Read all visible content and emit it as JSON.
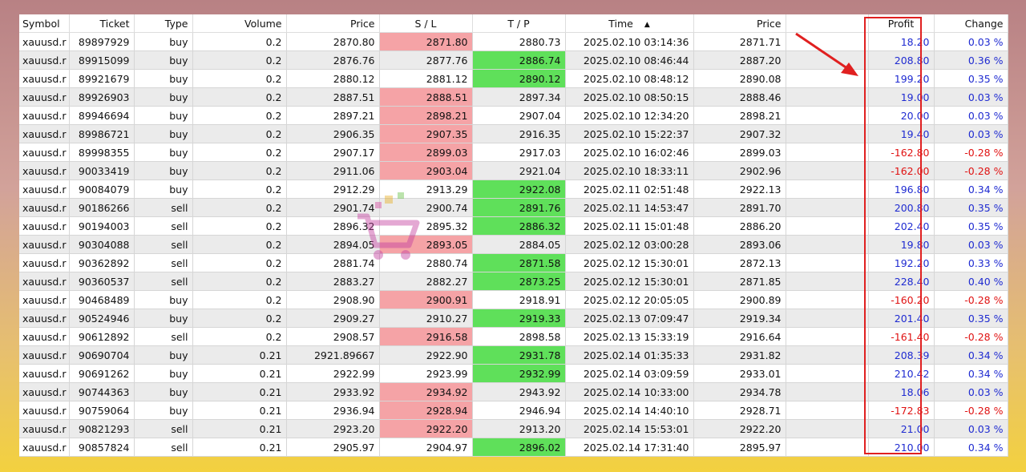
{
  "columns": {
    "symbol": "Symbol",
    "ticket": "Ticket",
    "type": "Type",
    "volume": "Volume",
    "price_open": "Price",
    "sl": "S / L",
    "tp": "T / P",
    "time": "Time",
    "price_current": "Price",
    "profit": "Profit",
    "change": "Change"
  },
  "sort": {
    "column": "time",
    "direction": "ascending",
    "icon": "sort-up-icon"
  },
  "highlight": {
    "column": "profit",
    "color": "#e02020"
  },
  "colors": {
    "sl_hit": "#f5a3a6",
    "tp_hit": "#5fe05a",
    "positive": "#1f2bd1",
    "negative": "#e01212"
  },
  "rows": [
    {
      "symbol": "xauusd.r",
      "ticket": "89897929",
      "type": "buy",
      "volume": "0.2",
      "price": "2870.80",
      "sl": "2871.80",
      "tp": "2880.73",
      "time": "2025.02.10 03:14:36",
      "price2": "2871.71",
      "profit": "18.20",
      "change": "0.03 %",
      "sl_hit": true,
      "tp_hit": false,
      "neg": false
    },
    {
      "symbol": "xauusd.r",
      "ticket": "89915099",
      "type": "buy",
      "volume": "0.2",
      "price": "2876.76",
      "sl": "2877.76",
      "tp": "2886.74",
      "time": "2025.02.10 08:46:44",
      "price2": "2887.20",
      "profit": "208.80",
      "change": "0.36 %",
      "sl_hit": false,
      "tp_hit": true,
      "neg": false
    },
    {
      "symbol": "xauusd.r",
      "ticket": "89921679",
      "type": "buy",
      "volume": "0.2",
      "price": "2880.12",
      "sl": "2881.12",
      "tp": "2890.12",
      "time": "2025.02.10 08:48:12",
      "price2": "2890.08",
      "profit": "199.20",
      "change": "0.35 %",
      "sl_hit": false,
      "tp_hit": true,
      "neg": false
    },
    {
      "symbol": "xauusd.r",
      "ticket": "89926903",
      "type": "buy",
      "volume": "0.2",
      "price": "2887.51",
      "sl": "2888.51",
      "tp": "2897.34",
      "time": "2025.02.10 08:50:15",
      "price2": "2888.46",
      "profit": "19.00",
      "change": "0.03 %",
      "sl_hit": true,
      "tp_hit": false,
      "neg": false
    },
    {
      "symbol": "xauusd.r",
      "ticket": "89946694",
      "type": "buy",
      "volume": "0.2",
      "price": "2897.21",
      "sl": "2898.21",
      "tp": "2907.04",
      "time": "2025.02.10 12:34:20",
      "price2": "2898.21",
      "profit": "20.00",
      "change": "0.03 %",
      "sl_hit": true,
      "tp_hit": false,
      "neg": false
    },
    {
      "symbol": "xauusd.r",
      "ticket": "89986721",
      "type": "buy",
      "volume": "0.2",
      "price": "2906.35",
      "sl": "2907.35",
      "tp": "2916.35",
      "time": "2025.02.10 15:22:37",
      "price2": "2907.32",
      "profit": "19.40",
      "change": "0.03 %",
      "sl_hit": true,
      "tp_hit": false,
      "neg": false
    },
    {
      "symbol": "xauusd.r",
      "ticket": "89998355",
      "type": "buy",
      "volume": "0.2",
      "price": "2907.17",
      "sl": "2899.03",
      "tp": "2917.03",
      "time": "2025.02.10 16:02:46",
      "price2": "2899.03",
      "profit": "-162.80",
      "change": "-0.28 %",
      "sl_hit": true,
      "tp_hit": false,
      "neg": true
    },
    {
      "symbol": "xauusd.r",
      "ticket": "90033419",
      "type": "buy",
      "volume": "0.2",
      "price": "2911.06",
      "sl": "2903.04",
      "tp": "2921.04",
      "time": "2025.02.10 18:33:11",
      "price2": "2902.96",
      "profit": "-162.00",
      "change": "-0.28 %",
      "sl_hit": true,
      "tp_hit": false,
      "neg": true
    },
    {
      "symbol": "xauusd.r",
      "ticket": "90084079",
      "type": "buy",
      "volume": "0.2",
      "price": "2912.29",
      "sl": "2913.29",
      "tp": "2922.08",
      "time": "2025.02.11 02:51:48",
      "price2": "2922.13",
      "profit": "196.80",
      "change": "0.34 %",
      "sl_hit": false,
      "tp_hit": true,
      "neg": false
    },
    {
      "symbol": "xauusd.r",
      "ticket": "90186266",
      "type": "sell",
      "volume": "0.2",
      "price": "2901.74",
      "sl": "2900.74",
      "tp": "2891.76",
      "time": "2025.02.11 14:53:47",
      "price2": "2891.70",
      "profit": "200.80",
      "change": "0.35 %",
      "sl_hit": false,
      "tp_hit": true,
      "neg": false
    },
    {
      "symbol": "xauusd.r",
      "ticket": "90194003",
      "type": "sell",
      "volume": "0.2",
      "price": "2896.32",
      "sl": "2895.32",
      "tp": "2886.32",
      "time": "2025.02.11 15:01:48",
      "price2": "2886.20",
      "profit": "202.40",
      "change": "0.35 %",
      "sl_hit": false,
      "tp_hit": true,
      "neg": false
    },
    {
      "symbol": "xauusd.r",
      "ticket": "90304088",
      "type": "sell",
      "volume": "0.2",
      "price": "2894.05",
      "sl": "2893.05",
      "tp": "2884.05",
      "time": "2025.02.12 03:00:28",
      "price2": "2893.06",
      "profit": "19.80",
      "change": "0.03 %",
      "sl_hit": true,
      "tp_hit": false,
      "neg": false
    },
    {
      "symbol": "xauusd.r",
      "ticket": "90362892",
      "type": "sell",
      "volume": "0.2",
      "price": "2881.74",
      "sl": "2880.74",
      "tp": "2871.58",
      "time": "2025.02.12 15:30:01",
      "price2": "2872.13",
      "profit": "192.20",
      "change": "0.33 %",
      "sl_hit": false,
      "tp_hit": true,
      "neg": false
    },
    {
      "symbol": "xauusd.r",
      "ticket": "90360537",
      "type": "sell",
      "volume": "0.2",
      "price": "2883.27",
      "sl": "2882.27",
      "tp": "2873.25",
      "time": "2025.02.12 15:30:01",
      "price2": "2871.85",
      "profit": "228.40",
      "change": "0.40 %",
      "sl_hit": false,
      "tp_hit": true,
      "neg": false
    },
    {
      "symbol": "xauusd.r",
      "ticket": "90468489",
      "type": "buy",
      "volume": "0.2",
      "price": "2908.90",
      "sl": "2900.91",
      "tp": "2918.91",
      "time": "2025.02.12 20:05:05",
      "price2": "2900.89",
      "profit": "-160.20",
      "change": "-0.28 %",
      "sl_hit": true,
      "tp_hit": false,
      "neg": true
    },
    {
      "symbol": "xauusd.r",
      "ticket": "90524946",
      "type": "buy",
      "volume": "0.2",
      "price": "2909.27",
      "sl": "2910.27",
      "tp": "2919.33",
      "time": "2025.02.13 07:09:47",
      "price2": "2919.34",
      "profit": "201.40",
      "change": "0.35 %",
      "sl_hit": false,
      "tp_hit": true,
      "neg": false
    },
    {
      "symbol": "xauusd.r",
      "ticket": "90612892",
      "type": "sell",
      "volume": "0.2",
      "price": "2908.57",
      "sl": "2916.58",
      "tp": "2898.58",
      "time": "2025.02.13 15:33:19",
      "price2": "2916.64",
      "profit": "-161.40",
      "change": "-0.28 %",
      "sl_hit": true,
      "tp_hit": false,
      "neg": true
    },
    {
      "symbol": "xauusd.r",
      "ticket": "90690704",
      "type": "buy",
      "volume": "0.21",
      "price": "2921.89667",
      "sl": "2922.90",
      "tp": "2931.78",
      "time": "2025.02.14 01:35:33",
      "price2": "2931.82",
      "profit": "208.39",
      "change": "0.34 %",
      "sl_hit": false,
      "tp_hit": true,
      "neg": false
    },
    {
      "symbol": "xauusd.r",
      "ticket": "90691262",
      "type": "buy",
      "volume": "0.21",
      "price": "2922.99",
      "sl": "2923.99",
      "tp": "2932.99",
      "time": "2025.02.14 03:09:59",
      "price2": "2933.01",
      "profit": "210.42",
      "change": "0.34 %",
      "sl_hit": false,
      "tp_hit": true,
      "neg": false
    },
    {
      "symbol": "xauusd.r",
      "ticket": "90744363",
      "type": "buy",
      "volume": "0.21",
      "price": "2933.92",
      "sl": "2934.92",
      "tp": "2943.92",
      "time": "2025.02.14 10:33:00",
      "price2": "2934.78",
      "profit": "18.06",
      "change": "0.03 %",
      "sl_hit": true,
      "tp_hit": false,
      "neg": false
    },
    {
      "symbol": "xauusd.r",
      "ticket": "90759064",
      "type": "buy",
      "volume": "0.21",
      "price": "2936.94",
      "sl": "2928.94",
      "tp": "2946.94",
      "time": "2025.02.14 14:40:10",
      "price2": "2928.71",
      "profit": "-172.83",
      "change": "-0.28 %",
      "sl_hit": true,
      "tp_hit": false,
      "neg": true
    },
    {
      "symbol": "xauusd.r",
      "ticket": "90821293",
      "type": "sell",
      "volume": "0.21",
      "price": "2923.20",
      "sl": "2922.20",
      "tp": "2913.20",
      "time": "2025.02.14 15:53:01",
      "price2": "2922.20",
      "profit": "21.00",
      "change": "0.03 %",
      "sl_hit": true,
      "tp_hit": false,
      "neg": false
    },
    {
      "symbol": "xauusd.r",
      "ticket": "90857824",
      "type": "sell",
      "volume": "0.21",
      "price": "2905.97",
      "sl": "2904.97",
      "tp": "2896.02",
      "time": "2025.02.14 17:31:40",
      "price2": "2895.97",
      "profit": "210.00",
      "change": "0.34 %",
      "sl_hit": false,
      "tp_hit": true,
      "neg": false
    }
  ]
}
